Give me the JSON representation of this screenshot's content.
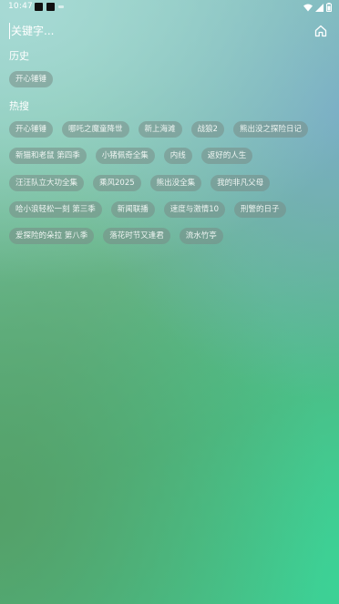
{
  "status_bar": {
    "time": "10:47"
  },
  "search": {
    "placeholder": "关键字..."
  },
  "history": {
    "title": "历史",
    "items": [
      "开心锤锤"
    ]
  },
  "hot": {
    "title": "热搜",
    "rows": [
      [
        "开心锤锤",
        "哪吒之魔童降世",
        "新上海滩",
        "战狼2",
        "熊出没之探险日记"
      ],
      [
        "新猫和老鼠 第四季",
        "小猪佩奇全集",
        "内线",
        "返好的人生"
      ],
      [
        "汪汪队立大功全集",
        "乘风2025",
        "熊出没全集",
        "我的非凡父母"
      ],
      [
        "哈小浪轻松一刻 第三季",
        "新闻联播",
        "速度与激情10",
        "刑警的日子"
      ],
      [
        "爱探险的朵拉 第八季",
        "落花时节又逢君",
        "流水竹亭"
      ]
    ]
  },
  "icons": {
    "wifi": "wifi-icon",
    "signal": "signal-icon",
    "battery": "battery-icon",
    "home": "home-icon"
  }
}
